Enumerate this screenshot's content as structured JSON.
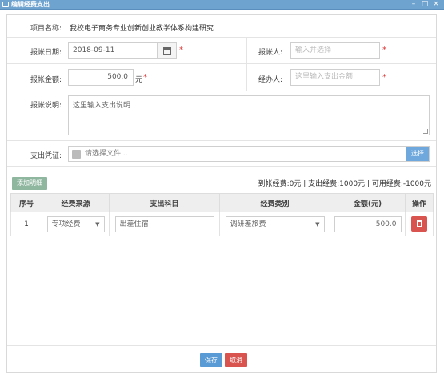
{
  "window": {
    "title": "编辑经费支出",
    "controls": {
      "minimize": "–",
      "maximize": "□",
      "close": "×"
    }
  },
  "form": {
    "project_label": "项目名称:",
    "project_value": "我校电子商务专业创新创业教学体系构建研究",
    "date_label": "报帐日期:",
    "date_value": "2018-09-11",
    "reimburser_label": "报帐人:",
    "reimburser_placeholder": "输入并选择",
    "amount_label": "报帐金额:",
    "amount_value": "500.0",
    "amount_unit": "元",
    "handler_label": "经办人:",
    "handler_placeholder": "这里输入支出金额",
    "desc_label": "报帐说明:",
    "desc_placeholder": "这里输入支出说明",
    "voucher_label": "支出凭证:",
    "voucher_placeholder": "请选择文件...",
    "voucher_button": "选择",
    "required_mark": "*"
  },
  "details": {
    "add_button": "添加明细",
    "summary": "到帐经费:0元 | 支出经费:1000元 | 可用经费:-1000元",
    "columns": [
      "序号",
      "经费来源",
      "支出科目",
      "经费类别",
      "金额(元)",
      "操作"
    ],
    "rows": [
      {
        "index": "1",
        "source": "专项经费",
        "subject": "出差住宿",
        "category": "调研差旅费",
        "amount": "500.0"
      }
    ]
  },
  "footer": {
    "save": "保存",
    "cancel": "取消"
  },
  "colors": {
    "titlebar": "#6fa3cf",
    "primary": "#5b9bd5",
    "danger": "#d9534f",
    "add_button": "#8fb69f"
  }
}
